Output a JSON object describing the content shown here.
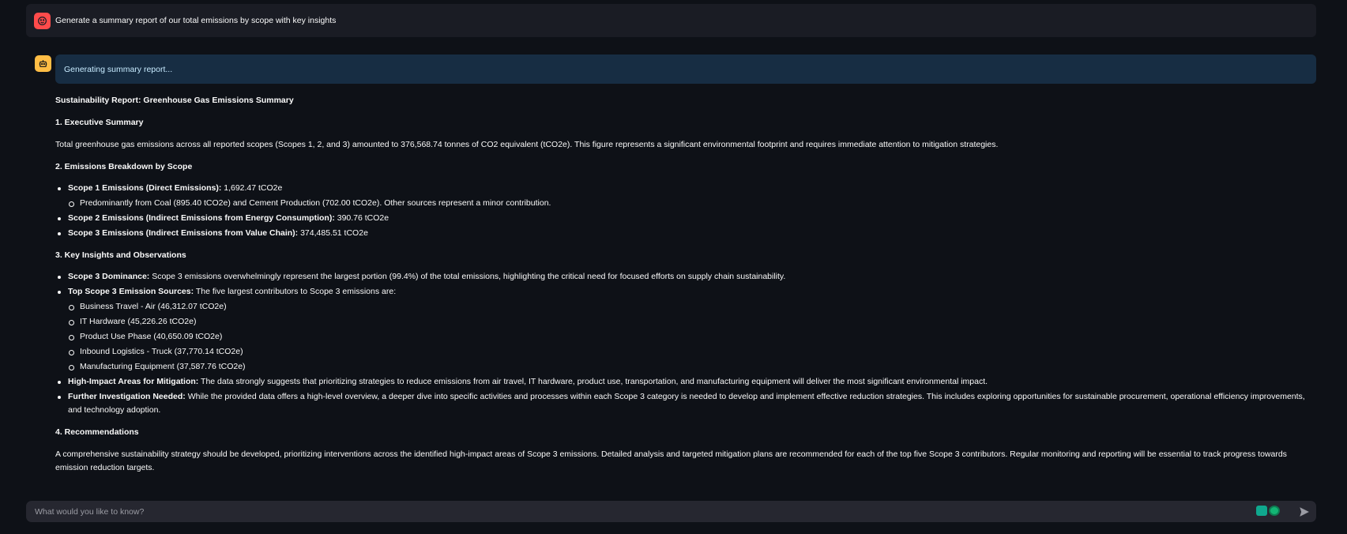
{
  "user_message": {
    "text": "Generate a summary report of our total emissions by scope with key insights"
  },
  "assistant": {
    "status": "Generating summary report...",
    "report": {
      "title": "Sustainability Report: Greenhouse Gas Emissions Summary",
      "exec_heading": "1. Executive Summary",
      "exec_text": "Total greenhouse gas emissions across all reported scopes (Scopes 1, 2, and 3) amounted to 376,568.74 tonnes of CO2 equivalent (tCO2e). This figure represents a significant environmental footprint and requires immediate attention to mitigation strategies.",
      "breakdown_heading": "2. Emissions Breakdown by Scope",
      "scope1_label": "Scope 1 Emissions (Direct Emissions):",
      "scope1_value": " 1,692.47 tCO2e",
      "scope1_detail": "Predominantly from Coal (895.40 tCO2e) and Cement Production (702.00 tCO2e). Other sources represent a minor contribution.",
      "scope2_label": "Scope 2 Emissions (Indirect Emissions from Energy Consumption):",
      "scope2_value": " 390.76 tCO2e",
      "scope3_label": "Scope 3 Emissions (Indirect Emissions from Value Chain):",
      "scope3_value": " 374,485.51 tCO2e",
      "insights_heading": "3. Key Insights and Observations",
      "dominance_label": "Scope 3 Dominance:",
      "dominance_text": " Scope 3 emissions overwhelmingly represent the largest portion (99.4%) of the total emissions, highlighting the critical need for focused efforts on supply chain sustainability.",
      "top_label": "Top Scope 3 Emission Sources:",
      "top_text": " The five largest contributors to Scope 3 emissions are:",
      "top_sources": [
        "Business Travel - Air (46,312.07 tCO2e)",
        "IT Hardware (45,226.26 tCO2e)",
        "Product Use Phase (40,650.09 tCO2e)",
        "Inbound Logistics - Truck (37,770.14 tCO2e)",
        "Manufacturing Equipment (37,587.76 tCO2e)"
      ],
      "impact_label": "High-Impact Areas for Mitigation:",
      "impact_text": " The data strongly suggests that prioritizing strategies to reduce emissions from air travel, IT hardware, product use, transportation, and manufacturing equipment will deliver the most significant environmental impact.",
      "further_label": "Further Investigation Needed:",
      "further_text": " While the provided data offers a high-level overview, a deeper dive into specific activities and processes within each Scope 3 category is needed to develop and implement effective reduction strategies. This includes exploring opportunities for sustainable procurement, operational efficiency improvements, and technology adoption.",
      "rec_heading": "4. Recommendations",
      "rec_text": "A comprehensive sustainability strategy should be developed, prioritizing interventions across the identified high-impact areas of Scope 3 emissions. Detailed analysis and targeted mitigation plans are recommended for each of the top five Scope 3 contributors. Regular monitoring and reporting will be essential to track progress towards emission reduction targets."
    }
  },
  "chat_input": {
    "placeholder": "What would you like to know?"
  },
  "icons": {
    "user_avatar": "user-face-icon",
    "bot_avatar": "robot-icon",
    "send": "send-icon"
  }
}
